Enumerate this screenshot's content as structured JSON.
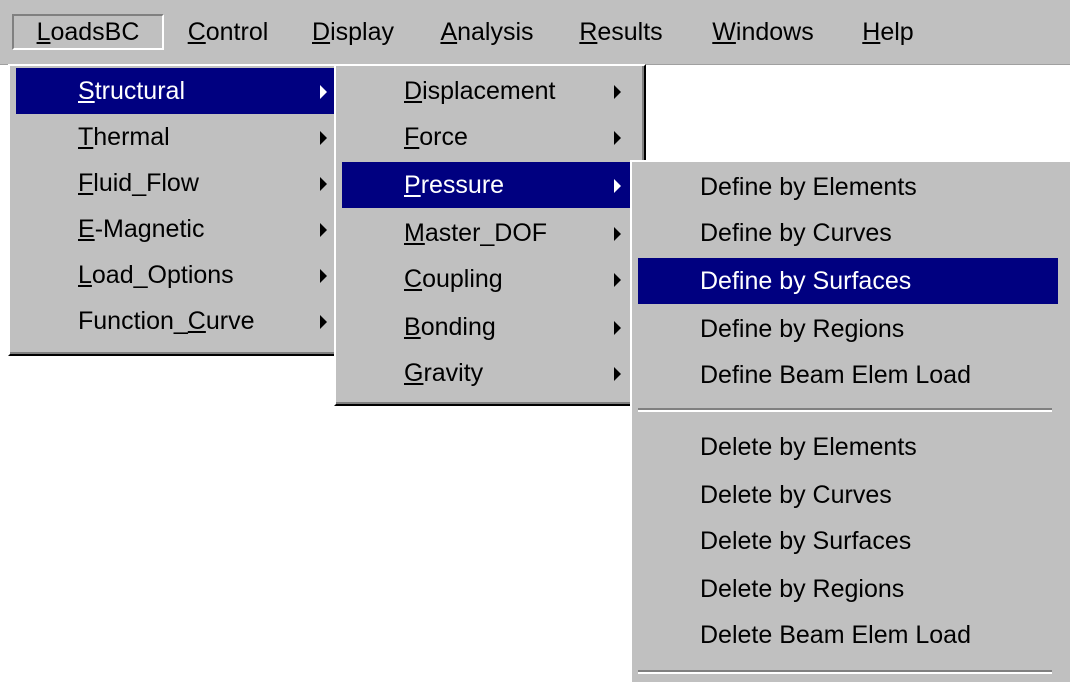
{
  "menubar": [
    {
      "pre": "",
      "key": "L",
      "post": "oadsBC",
      "active": true
    },
    {
      "pre": "",
      "key": "C",
      "post": "ontrol"
    },
    {
      "pre": "",
      "key": "D",
      "post": "isplay"
    },
    {
      "pre": "",
      "key": "A",
      "post": "nalysis"
    },
    {
      "pre": "",
      "key": "R",
      "post": "esults"
    },
    {
      "pre": "",
      "key": "W",
      "post": "indows"
    },
    {
      "pre": "",
      "key": "H",
      "post": "elp"
    }
  ],
  "loadsbc_menu": [
    {
      "pre": "",
      "key": "S",
      "post": "tructural",
      "selected": true
    },
    {
      "pre": "",
      "key": "T",
      "post": "hermal"
    },
    {
      "pre": "",
      "key": "F",
      "post": "luid_Flow"
    },
    {
      "pre": "",
      "key": "E",
      "post": "-Magnetic"
    },
    {
      "pre": "",
      "key": "L",
      "post": "oad_Options"
    },
    {
      "pre": "Function_",
      "key": "C",
      "post": "urve"
    }
  ],
  "structural_menu": [
    {
      "pre": "",
      "key": "D",
      "post": "isplacement"
    },
    {
      "pre": "",
      "key": "F",
      "post": "orce"
    },
    {
      "pre": "",
      "key": "P",
      "post": "ressure",
      "selected": true
    },
    {
      "pre": "",
      "key": "M",
      "post": "aster_DOF"
    },
    {
      "pre": "",
      "key": "C",
      "post": "oupling"
    },
    {
      "pre": "",
      "key": "B",
      "post": "onding"
    },
    {
      "pre": "",
      "key": "G",
      "post": "ravity"
    }
  ],
  "pressure_menu": {
    "define": [
      "Define by Elements",
      "Define by Curves",
      "Define by Surfaces",
      "Define by Regions",
      "Define Beam Elem Load"
    ],
    "define_selected_index": 2,
    "delete": [
      "Delete by Elements",
      "Delete by Curves",
      "Delete by Surfaces",
      "Delete by Regions",
      "Delete Beam Elem Load"
    ]
  },
  "colors": {
    "menu_bg": "#c0c0c0",
    "highlight": "#000080"
  }
}
